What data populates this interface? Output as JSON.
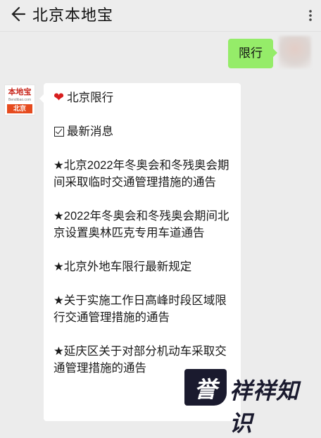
{
  "header": {
    "title": "北京本地宝",
    "back_icon": "back-arrow-icon",
    "more_icon": "more-vertical-icon"
  },
  "user_message": {
    "text": "限行"
  },
  "bot_avatar": {
    "logo_text": "本地宝",
    "logo_sub": "Bendibao.com",
    "city": "北京"
  },
  "bot_message": {
    "heading": "北京限行",
    "heading_icon": "heart-icon",
    "section_title": "最新消息",
    "section_icon": "checkbox-icon",
    "items": [
      "★北京2022年冬奥会和冬残奥会期间采取临时交通管理措施的通告",
      "★2022年冬奥会和冬残奥会期间北京设置奥林匹克专用车道通告",
      "★北京外地车限行最新规定",
      "★关于实施工作日高峰时段区域限行交通管理措施的通告",
      "★延庆区关于对部分机动车采取交通管理措施的通告"
    ]
  },
  "watermark": {
    "shield_char": "誉",
    "text": "祥祥知识"
  },
  "colors": {
    "accent_green": "#95ec69",
    "background": "#ededed",
    "heart": "#d81e1e"
  }
}
